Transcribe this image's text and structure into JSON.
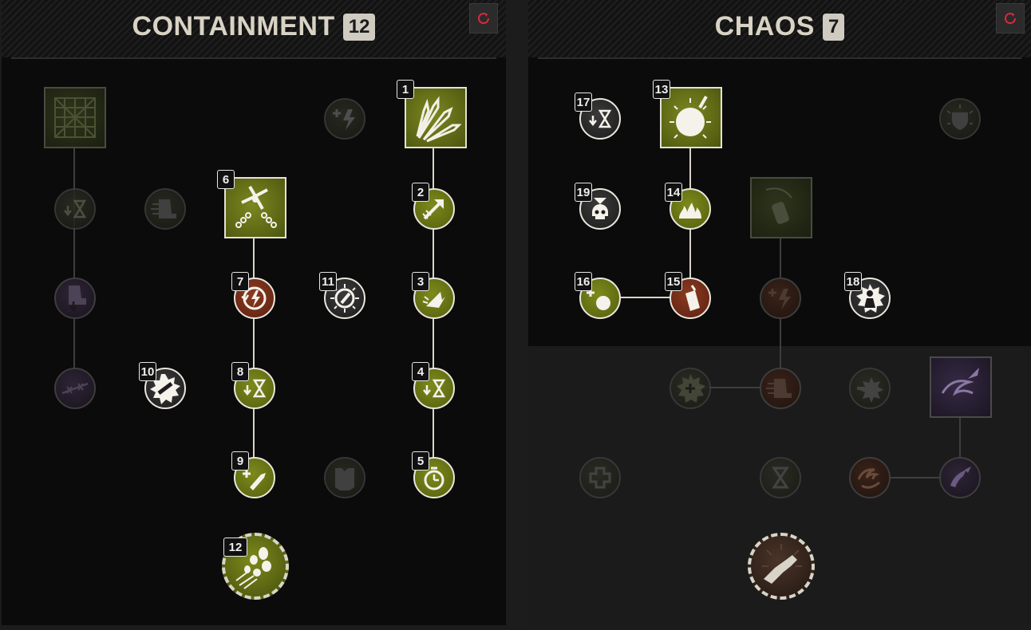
{
  "trees": [
    {
      "title": "CONTAINMENT",
      "points": "12",
      "reset_icon": "reset-icon",
      "ultimate_badge": "12",
      "nodes": [
        {
          "id": "net-trap",
          "icon": "net-icon",
          "state": "dim"
        },
        {
          "id": "lightning-plus",
          "icon": "lightning-plus-icon",
          "state": "dim"
        },
        {
          "id": "crystal-shards",
          "icon": "crystal-shards-icon",
          "state": "active",
          "badge": "1"
        },
        {
          "id": "hourglass-down-1",
          "icon": "hourglass-down-icon",
          "state": "dim"
        },
        {
          "id": "boot-dash",
          "icon": "boot-dash-icon",
          "state": "dim"
        },
        {
          "id": "chain-blade",
          "icon": "chain-blade-icon",
          "state": "active",
          "badge": "6"
        },
        {
          "id": "arrow-up-right",
          "icon": "arrow-up-right-icon",
          "state": "active",
          "badge": "2"
        },
        {
          "id": "boot-down",
          "icon": "boot-down-icon",
          "state": "dim"
        },
        {
          "id": "lightning-cycle",
          "icon": "lightning-cycle-icon",
          "state": "red",
          "badge": "7"
        },
        {
          "id": "sun-bolt",
          "icon": "sun-bolt-icon",
          "state": "white",
          "badge": "11"
        },
        {
          "id": "shard-burst",
          "icon": "shard-burst-icon",
          "state": "active",
          "badge": "3"
        },
        {
          "id": "barbed-wire",
          "icon": "barbed-wire-icon",
          "state": "dim"
        },
        {
          "id": "bandage-burst",
          "icon": "bandage-burst-icon",
          "state": "white",
          "badge": "10"
        },
        {
          "id": "hourglass-down-2",
          "icon": "hourglass-down-icon",
          "state": "active",
          "badge": "8"
        },
        {
          "id": "hourglass-down-3",
          "icon": "hourglass-down-icon",
          "state": "active",
          "badge": "4"
        },
        {
          "id": "ammo-plus",
          "icon": "ammo-plus-icon",
          "state": "active",
          "badge": "9"
        },
        {
          "id": "armor",
          "icon": "armor-icon",
          "state": "dim"
        },
        {
          "id": "stopwatch",
          "icon": "stopwatch-icon",
          "state": "active",
          "badge": "5"
        }
      ]
    },
    {
      "title": "CHAOS",
      "points": "7",
      "reset_icon": "reset-icon",
      "nodes": [
        {
          "id": "hourglass-down-c1",
          "icon": "hourglass-down-icon",
          "state": "white",
          "badge": "17"
        },
        {
          "id": "fireball",
          "icon": "fireball-icon",
          "state": "active",
          "badge": "13"
        },
        {
          "id": "shield-burst",
          "icon": "shield-burst-icon",
          "state": "dim"
        },
        {
          "id": "skull-hourglass",
          "icon": "skull-hourglass-icon",
          "state": "white",
          "badge": "19"
        },
        {
          "id": "fire",
          "icon": "fire-icon",
          "state": "active",
          "badge": "14"
        },
        {
          "id": "canister-throw",
          "icon": "canister-throw-icon",
          "state": "dim"
        },
        {
          "id": "grenade-plus",
          "icon": "grenade-plus-icon",
          "state": "active",
          "badge": "16"
        },
        {
          "id": "molotov",
          "icon": "molotov-icon",
          "state": "red",
          "badge": "15"
        },
        {
          "id": "lightning-plus-red",
          "icon": "lightning-plus-icon",
          "state": "dimred"
        },
        {
          "id": "silhouette-burst",
          "icon": "silhouette-burst-icon",
          "state": "white",
          "badge": "18"
        },
        {
          "id": "bandage-plus",
          "icon": "bandage-plus-icon",
          "state": "dim"
        },
        {
          "id": "boot-dash-red",
          "icon": "boot-dash-icon",
          "state": "dimred"
        },
        {
          "id": "bullet-burst",
          "icon": "bullet-burst-icon",
          "state": "dim"
        },
        {
          "id": "vortex-missile",
          "icon": "vortex-missile-icon",
          "state": "dimpurple"
        },
        {
          "id": "medkit",
          "icon": "medkit-icon",
          "state": "dim"
        },
        {
          "id": "hourglass-dim",
          "icon": "hourglass-icon",
          "state": "dim"
        },
        {
          "id": "vortex",
          "icon": "vortex-icon",
          "state": "dimred"
        },
        {
          "id": "swirl-strike",
          "icon": "swirl-strike-icon",
          "state": "dimpurple"
        }
      ]
    }
  ]
}
